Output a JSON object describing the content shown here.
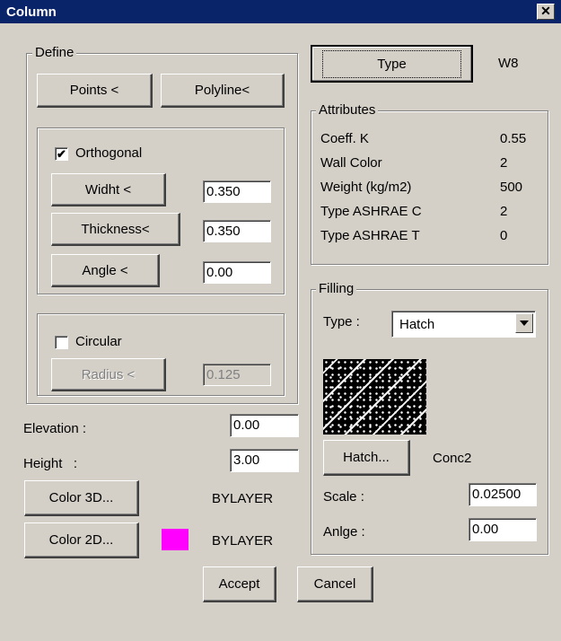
{
  "window": {
    "title": "Column",
    "close_glyph": "✕"
  },
  "define": {
    "title": "Define",
    "points_button": "Points <",
    "polyline_button": "Polyline<",
    "orthogonal": {
      "label": "Orthogonal",
      "checked": true,
      "check_glyph": "✔",
      "width_button": "Widht <",
      "width_value": "0.350",
      "thickness_button": "Thickness<",
      "thickness_value": "0.350",
      "angle_button": "Angle <",
      "angle_value": "0.00"
    },
    "circular": {
      "label": "Circular",
      "checked": false,
      "radius_button": "Radius <",
      "radius_value": "0.125"
    }
  },
  "elevation": {
    "label": "Elevation :",
    "value": "0.00"
  },
  "height": {
    "label": "Height   :",
    "value": "3.00"
  },
  "color3d": {
    "button": "Color 3D...",
    "value": "BYLAYER"
  },
  "color2d": {
    "button": "Color 2D...",
    "value": "BYLAYER",
    "swatch_color": "#ff00ff"
  },
  "type": {
    "button": "Type",
    "value": "W8"
  },
  "attributes": {
    "title": "Attributes",
    "rows": [
      {
        "label": "Coeff. K",
        "value": "0.55"
      },
      {
        "label": "Wall Color",
        "value": "2"
      },
      {
        "label": "Weight (kg/m2)",
        "value": "500"
      },
      {
        "label": "Type ASHRAE C",
        "value": "2"
      },
      {
        "label": "Type ASHRAE T",
        "value": "0"
      }
    ]
  },
  "filling": {
    "title": "Filling",
    "type_label": "Type :",
    "type_selected": "Hatch",
    "hatch_button": "Hatch...",
    "hatch_name": "Conc2",
    "scale_label": "Scale :",
    "scale_value": "0.02500",
    "angle_label": "Anlge :",
    "angle_value": "0.00"
  },
  "footer": {
    "accept_button": "Accept",
    "cancel_button": "Cancel"
  }
}
